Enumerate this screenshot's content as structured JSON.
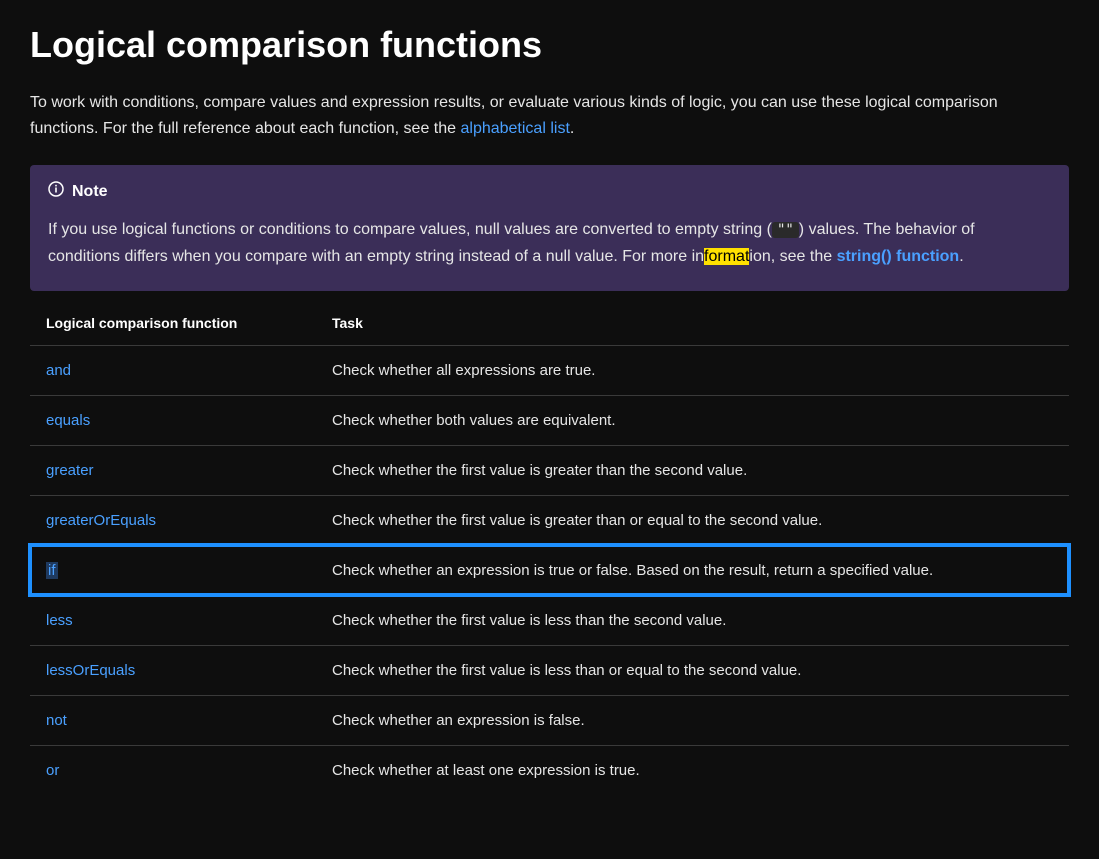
{
  "heading": "Logical comparison functions",
  "intro": {
    "text_before_link": "To work with conditions, compare values and expression results, or evaluate various kinds of logic, you can use these logical comparison functions. For the full reference about each function, see the ",
    "link_text": "alphabetical list",
    "text_after_link": "."
  },
  "note": {
    "label": "Note",
    "body_part1": "If you use logical functions or conditions to compare values, null values are converted to empty string (",
    "code_chip": "\"\"",
    "body_part2": ") values. The behavior of conditions differs when you compare with an empty string instead of a null value. For more in",
    "highlight_text": "format",
    "body_part3": "ion, see the ",
    "link_text": "string() function",
    "body_part4": "."
  },
  "table": {
    "header_fn": "Logical comparison function",
    "header_task": "Task",
    "rows": [
      {
        "fn": "and",
        "task": "Check whether all expressions are true.",
        "highlight": false
      },
      {
        "fn": "equals",
        "task": "Check whether both values are equivalent.",
        "highlight": false
      },
      {
        "fn": "greater",
        "task": "Check whether the first value is greater than the second value.",
        "highlight": false
      },
      {
        "fn": "greaterOrEquals",
        "task": "Check whether the first value is greater than or equal to the second value.",
        "highlight": false
      },
      {
        "fn": "if",
        "task": "Check whether an expression is true or false. Based on the result, return a specified value.",
        "highlight": true
      },
      {
        "fn": "less",
        "task": "Check whether the first value is less than the second value.",
        "highlight": false
      },
      {
        "fn": "lessOrEquals",
        "task": "Check whether the first value is less than or equal to the second value.",
        "highlight": false
      },
      {
        "fn": "not",
        "task": "Check whether an expression is false.",
        "highlight": false
      },
      {
        "fn": "or",
        "task": "Check whether at least one expression is true.",
        "highlight": false
      }
    ]
  }
}
